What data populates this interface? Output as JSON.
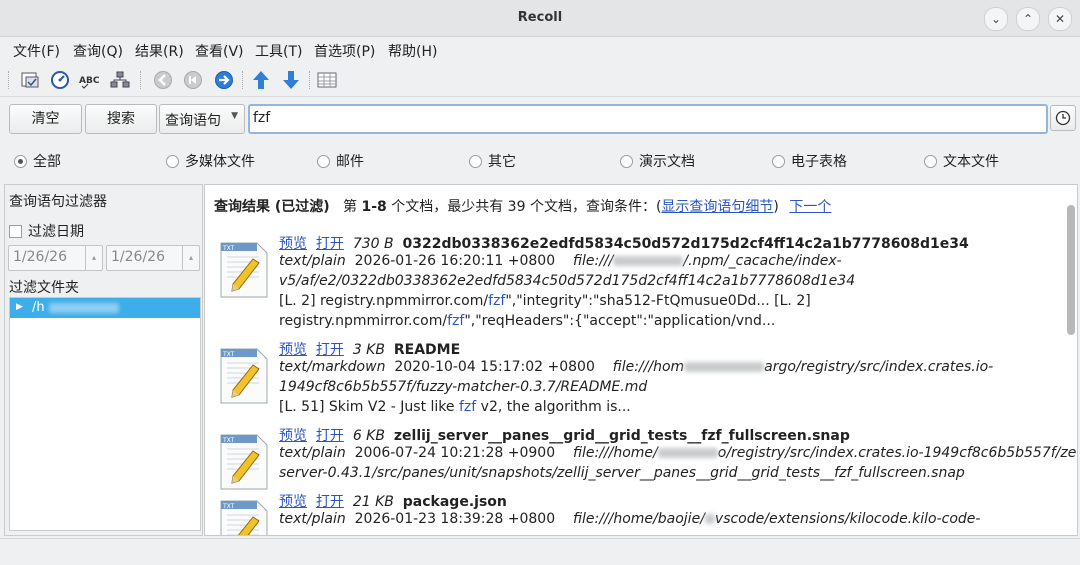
{
  "window": {
    "title": "Recoll"
  },
  "menu": [
    "文件(F)",
    "查询(Q)",
    "结果(R)",
    "查看(V)",
    "工具(T)",
    "首选项(P)",
    "帮助(H)"
  ],
  "toolbar_icons": [
    "spell-icon-1",
    "history-icon",
    "spelling-abc-icon",
    "network-icon",
    "prev-page-icon",
    "first-page-icon",
    "next-page-icon",
    "sort-up-icon",
    "sort-down-icon",
    "table-view-icon"
  ],
  "search": {
    "clear_label": "清空",
    "search_label": "搜索",
    "mode_label": "查询语句",
    "query_value": "fzf"
  },
  "categories": [
    {
      "label": "全部",
      "selected": true
    },
    {
      "label": "多媒体文件",
      "selected": false
    },
    {
      "label": "邮件",
      "selected": false
    },
    {
      "label": "其它",
      "selected": false
    },
    {
      "label": "演示文档",
      "selected": false
    },
    {
      "label": "电子表格",
      "selected": false
    },
    {
      "label": "文本文件",
      "selected": false
    }
  ],
  "sidebar": {
    "title": "查询语句过滤器",
    "filter_date_label": "过滤日期",
    "date_from": "1/26/26",
    "date_to": "1/26/26",
    "folder_label": "过滤文件夹",
    "folder_item": "/h"
  },
  "results": {
    "header_title": "查询结果 (已过滤)",
    "header_pre": "第 ",
    "header_range": "1-8",
    "header_post": " 个文档，最少共有 39 个文档，查询条件：(",
    "show_details_link": "显示查询语句细节",
    "header_close": ")",
    "next_link": "下一个",
    "preview_label": "预览",
    "open_label": "打开",
    "entries": [
      {
        "size": "730 B",
        "name": "0322db0338362e2edfd5834c50d572d175d2cf4ff14c2a1b7778608d1e34",
        "mime": "text/plain",
        "date": "2026-01-26 16:20:11 +0800",
        "path_a": "file:///",
        "path_b": "/.npm/_cacache/index-",
        "path_line2": "v5/af/e2/0322db0338362e2edfd5834c50d572d175d2cf4ff14c2a1b7778608d1e34",
        "abstract1_a": "[L. 2] registry.npmmirror.com/",
        "abstract1_hl": "fzf",
        "abstract1_b": "\",\"integrity\":\"sha512-FtQmusue0Dd... [L. 2]",
        "abstract2_a": "registry.npmmirror.com/",
        "abstract2_hl": "fzf",
        "abstract2_b": "\",\"reqHeaders\":{\"accept\":\"application/vnd..."
      },
      {
        "size": "3 KB",
        "name": "README",
        "mime": "text/markdown",
        "date": "2020-10-04 15:17:02 +0800",
        "path_a": "file:///hom",
        "path_b": "argo/registry/src/index.crates.io-",
        "path_line2": "1949cf8c6b5b557f/fuzzy-matcher-0.3.7/README.md",
        "abstract1_a": "[L. 51] Skim V2 - Just like ",
        "abstract1_hl": "fzf",
        "abstract1_b": " v2, the algorithm is..."
      },
      {
        "size": "6 KB",
        "name": "zellij_server__panes__grid__grid_tests__fzf_fullscreen.snap",
        "mime": "text/plain",
        "date": "2006-07-24 10:21:28 +0900",
        "path_a": "file:///home/",
        "path_b": "o/registry/src/index.crates.io-1949cf8c6b5b557f/zellij-",
        "path_line2": "server-0.43.1/src/panes/unit/snapshots/zellij_server__panes__grid__grid_tests__fzf_fullscreen.snap"
      },
      {
        "size": "21 KB",
        "name": "package.json",
        "mime": "text/plain",
        "date": "2026-01-23 18:39:28 +0800",
        "path_a": "file:///home/baojie/",
        "path_b": "vscode/extensions/kilocode.kilo-code-"
      }
    ]
  }
}
